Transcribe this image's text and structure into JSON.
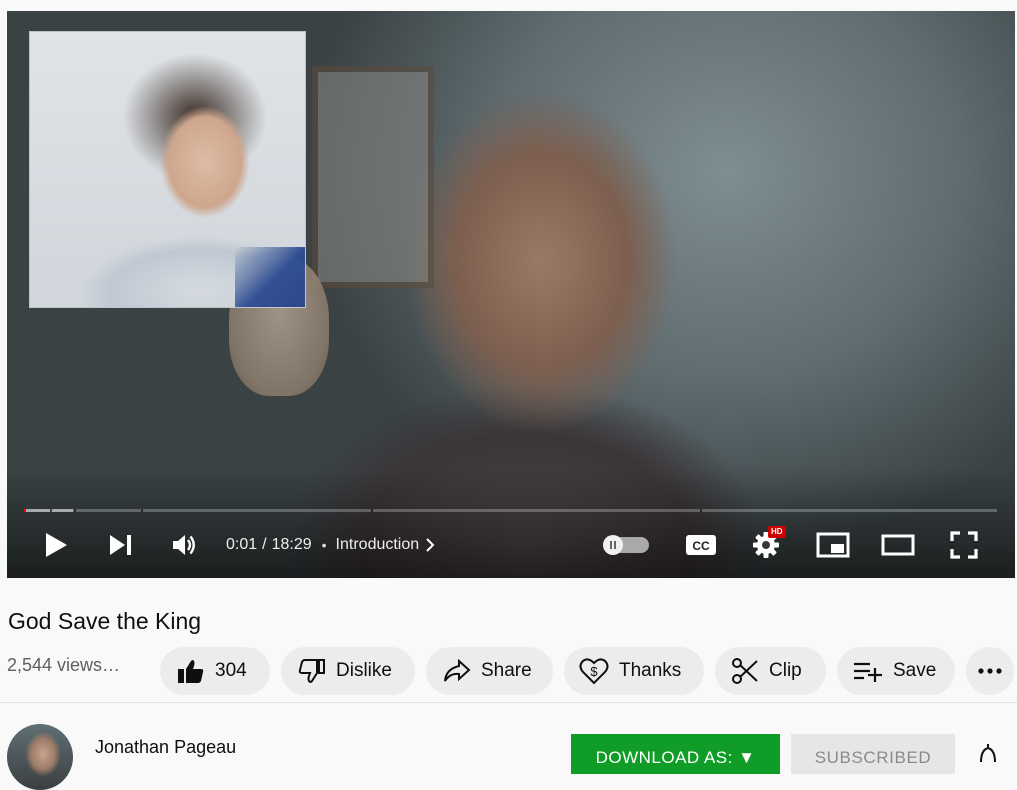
{
  "player": {
    "current_time": "0:01",
    "time_separator": "/",
    "duration": "18:29",
    "chapter_separator": "•",
    "chapter": "Introduction",
    "hd_badge": "HD",
    "progress_played_fraction": 0.001,
    "progress_buffered_fraction": 0.05,
    "chapter_boundaries_fraction": [
      0.027,
      0.051,
      0.12,
      0.357,
      0.695
    ],
    "icons": [
      "play-icon",
      "next-icon",
      "volume-icon",
      "chevron-right-icon",
      "autoplay-toggle",
      "captions-icon",
      "settings-icon",
      "miniplayer-icon",
      "theater-mode-icon",
      "fullscreen-icon"
    ]
  },
  "video": {
    "title": "God Save the King",
    "views": "2,544 views…"
  },
  "actions": {
    "like_count": "304",
    "dislike_label": "Dislike",
    "share_label": "Share",
    "thanks_label": "Thanks",
    "clip_label": "Clip",
    "save_label": "Save"
  },
  "channel": {
    "name": "Jonathan Pageau",
    "download_label": "DOWNLOAD AS: ▼",
    "subscribed_label": "SUBSCRIBED"
  },
  "colors": {
    "progress_red": "#ff0000",
    "download_green": "#0f9d28",
    "pill_bg": "#ececec"
  }
}
